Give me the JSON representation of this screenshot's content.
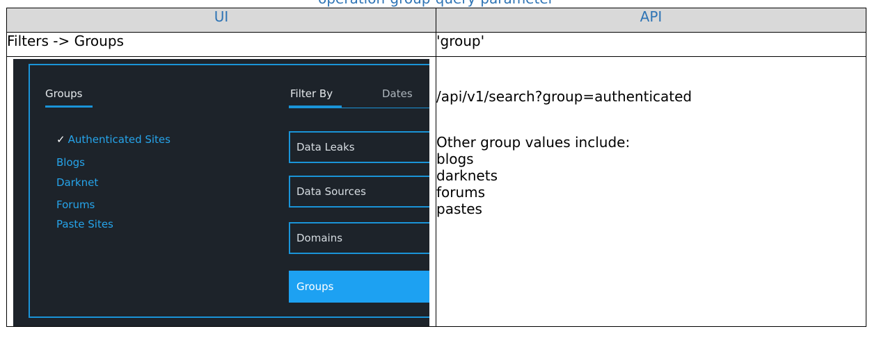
{
  "caption": "operation-group-query-parameter",
  "table": {
    "headers": [
      "UI",
      "API"
    ],
    "row1": {
      "ui": "Filters -> Groups",
      "api": "'group'"
    }
  },
  "screenshot": {
    "groups_tab": "Groups",
    "filter_by_tab": "Filter By",
    "dates_tab": "Dates",
    "group_items": [
      {
        "label": "Authenticated Sites",
        "checked": true
      },
      {
        "label": "Blogs"
      },
      {
        "label": "Darknet"
      },
      {
        "label": "Forums"
      },
      {
        "label": "Paste Sites"
      }
    ],
    "check_mark": "✓",
    "filter_buttons": [
      "Data Leaks",
      "Data Sources",
      "Domains",
      "Groups"
    ],
    "active_filter": "Groups",
    "colors": {
      "accent": "#1a94d8",
      "link": "#26a4ea",
      "background": "#1d232a",
      "active": "#1da1f2"
    }
  },
  "api": {
    "endpoint": "/api/v1/search?group=authenticated",
    "note": "Other group values include:",
    "values": [
      "blogs",
      "darknets",
      "forums",
      "pastes"
    ]
  }
}
